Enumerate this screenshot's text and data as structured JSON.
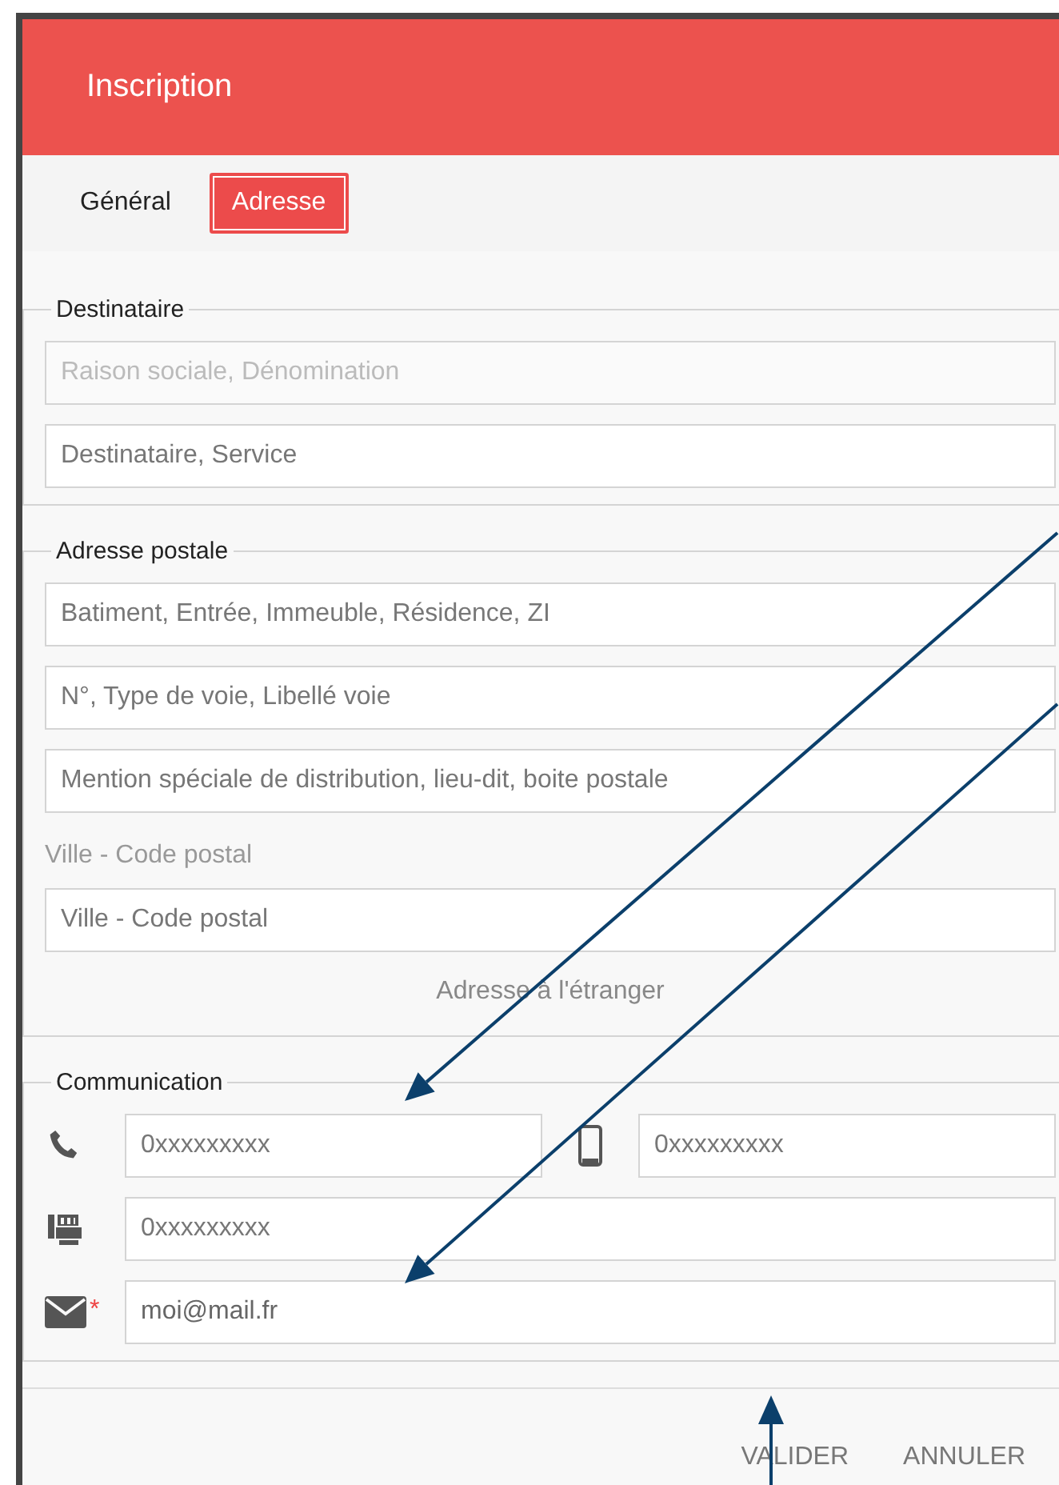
{
  "header": {
    "title": "Inscription"
  },
  "tabs": [
    {
      "label": "Général",
      "selected": false
    },
    {
      "label": "Adresse",
      "selected": true
    }
  ],
  "sections": [
    {
      "legend": "Destinataire",
      "items": [
        {
          "kind": "field",
          "placeholder": "Raison sociale, Dénomination",
          "disabled": true
        },
        {
          "kind": "field",
          "placeholder": "Destinataire, Service",
          "disabled": false
        }
      ]
    },
    {
      "legend": "Adresse postale",
      "items": [
        {
          "kind": "field",
          "placeholder": "Batiment, Entrée, Immeuble, Résidence, ZI",
          "disabled": false
        },
        {
          "kind": "field",
          "placeholder": "N°, Type de voie, Libellé voie",
          "disabled": false
        },
        {
          "kind": "field",
          "placeholder": "Mention spéciale de distribution, lieu-dit, boite postale",
          "disabled": false
        },
        {
          "kind": "label",
          "text": "Ville - Code postal"
        },
        {
          "kind": "field",
          "placeholder": "Ville - Code postal",
          "disabled": false
        },
        {
          "kind": "link",
          "text": "Adresse à l'étranger"
        }
      ]
    },
    {
      "legend": "Communication",
      "items": [
        {
          "kind": "contact",
          "entries": [
            {
              "kind": "phone",
              "placeholder": "0xxxxxxxxx"
            },
            {
              "kind": "mobile",
              "placeholder": "0xxxxxxxxx"
            }
          ]
        },
        {
          "kind": "contact",
          "entries": [
            {
              "kind": "fax",
              "placeholder": "0xxxxxxxxx"
            }
          ]
        },
        {
          "kind": "contact",
          "entries": [
            {
              "kind": "mail",
              "value": "moi@mail.fr",
              "required_mark": "*"
            }
          ]
        }
      ]
    }
  ],
  "buttons": [
    "VALIDER",
    "ANNULER"
  ],
  "annotations": [
    {
      "kind": "arrow"
    },
    {
      "kind": "arrow"
    },
    {
      "kind": "arrow"
    }
  ]
}
